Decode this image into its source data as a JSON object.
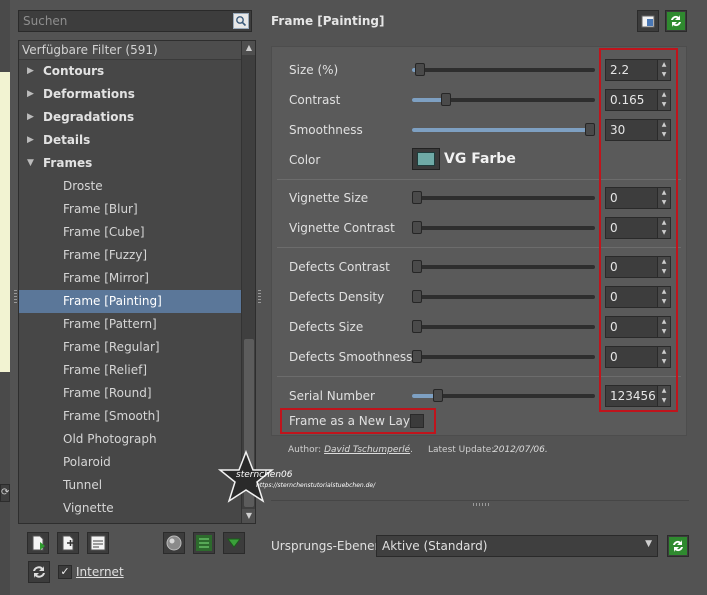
{
  "search": {
    "placeholder": "Suchen"
  },
  "tree": {
    "header": "Verfügbare Filter (591)",
    "items": [
      {
        "label": "Contours",
        "type": "category",
        "expanded": false
      },
      {
        "label": "Deformations",
        "type": "category",
        "expanded": false
      },
      {
        "label": "Degradations",
        "type": "category",
        "expanded": false
      },
      {
        "label": "Details",
        "type": "category",
        "expanded": false
      },
      {
        "label": "Frames",
        "type": "category",
        "expanded": true
      },
      {
        "label": "Droste",
        "type": "filter"
      },
      {
        "label": "Frame [Blur]",
        "type": "filter"
      },
      {
        "label": "Frame [Cube]",
        "type": "filter"
      },
      {
        "label": "Frame [Fuzzy]",
        "type": "filter"
      },
      {
        "label": "Frame [Mirror]",
        "type": "filter"
      },
      {
        "label": "Frame [Painting]",
        "type": "filter",
        "selected": true
      },
      {
        "label": "Frame [Pattern]",
        "type": "filter"
      },
      {
        "label": "Frame [Regular]",
        "type": "filter"
      },
      {
        "label": "Frame [Relief]",
        "type": "filter"
      },
      {
        "label": "Frame [Round]",
        "type": "filter"
      },
      {
        "label": "Frame [Smooth]",
        "type": "filter"
      },
      {
        "label": "Old Photograph",
        "type": "filter"
      },
      {
        "label": "Polaroid",
        "type": "filter"
      },
      {
        "label": "Tunnel",
        "type": "filter"
      },
      {
        "label": "Vignette",
        "type": "filter"
      }
    ]
  },
  "filter": {
    "title": "Frame [Painting]",
    "params": {
      "size": {
        "label": "Size (%)",
        "value": "2.2",
        "fraction": 0.02
      },
      "contrast": {
        "label": "Contrast",
        "value": "0.165",
        "fraction": 0.165
      },
      "smoothness": {
        "label": "Smoothness",
        "value": "30",
        "fraction": 1.0
      },
      "color": {
        "label": "Color",
        "name": "VG Farbe",
        "hex": "#6faaa6"
      },
      "vignette_size": {
        "label": "Vignette Size",
        "value": "0",
        "fraction": 0
      },
      "vignette_contrast": {
        "label": "Vignette Contrast",
        "value": "0",
        "fraction": 0
      },
      "defects_contrast": {
        "label": "Defects Contrast",
        "value": "0",
        "fraction": 0
      },
      "defects_density": {
        "label": "Defects Density",
        "value": "0",
        "fraction": 0
      },
      "defects_size": {
        "label": "Defects Size",
        "value": "0",
        "fraction": 0
      },
      "defects_smoothness": {
        "label": "Defects Smoothness",
        "value": "0",
        "fraction": 0
      },
      "serial_number": {
        "label": "Serial Number",
        "value": "123456",
        "fraction": 0.12
      },
      "new_layer": {
        "label": "Frame as a New Layer",
        "checked": false
      }
    },
    "author_label": "Author:",
    "author_name": "David Tschumperlé",
    "author_suffix": ".",
    "update_label": "Latest Update:",
    "update_date": "2012/07/06."
  },
  "layers": {
    "label": "Ursprungs-Ebenen",
    "value": "Aktive (Standard)"
  },
  "internet": {
    "label": "Internet",
    "checked": true
  },
  "watermark": {
    "name": "sternchen06",
    "url": "https://sternchenstutorialstuebchen.de/"
  },
  "colors": {
    "accent": "#5b7799",
    "slider_fill": "#7ea0c2",
    "highlight": "#c0141c",
    "refresh_green": "#3aa03a"
  }
}
